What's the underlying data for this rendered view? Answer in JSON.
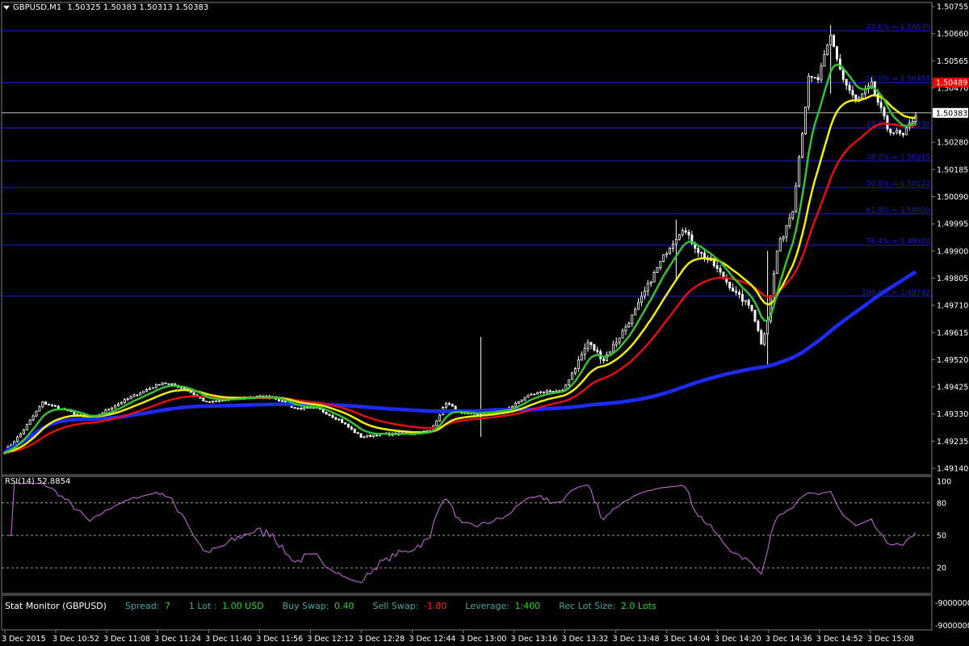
{
  "header": {
    "symbol_text": "GBPUSD,M1",
    "ohlc_text": "1.50325 1.50383 1.50313 1.50383"
  },
  "rsi_label": "RSI(14) 52.8854",
  "stat_monitor": {
    "title": "Stat Monitor (GBPUSD)",
    "spread_label": "Spread:",
    "spread_value": "7",
    "lot_label": "1 Lot :",
    "lot_value": "1.00 USD",
    "buy_swap_label": "Buy Swap:",
    "buy_swap_value": "0.40",
    "sell_swap_label": "Sell Swap:",
    "sell_swap_value": "-1.80",
    "leverage_label": "Leverage:",
    "leverage_value": "1:400",
    "rec_lot_label": "Rec Lot Size:",
    "rec_lot_value": "2.0 Lots"
  },
  "colors": {
    "background": "#000000",
    "grid": "#7f7f7f",
    "fib": "#1f1fd0",
    "candle": "#ffffff",
    "ema_fast": "#35c235",
    "ema_mid": "#f2f20f",
    "ema_slow": "#e01010",
    "sma_long": "#1d2bff",
    "rsi": "#b060c0",
    "current_price_line": "#c0c0c0",
    "price_tag": "#ff0000"
  },
  "chart_data": {
    "type": "candlestick",
    "price_axis": {
      "min": 1.4914,
      "max": 1.50755,
      "ticks": [
        "1.50755",
        "1.50660",
        "1.50565",
        "1.50470",
        "1.50375",
        "1.50280",
        "1.50185",
        "1.50090",
        "1.49995",
        "1.49900",
        "1.49805",
        "1.49710",
        "1.49615",
        "1.49520",
        "1.49425",
        "1.49330",
        "1.49235",
        "1.49140"
      ]
    },
    "time_labels": [
      "3 Dec 2015",
      "3 Dec 10:52",
      "3 Dec 11:08",
      "3 Dec 11:24",
      "3 Dec 11:40",
      "3 Dec 11:56",
      "3 Dec 12:12",
      "3 Dec 12:28",
      "3 Dec 12:44",
      "3 Dec 13:00",
      "3 Dec 13:16",
      "3 Dec 13:32",
      "3 Dec 13:48",
      "3 Dec 14:04",
      "3 Dec 14:20",
      "3 Dec 14:36",
      "3 Dec 14:52",
      "3 Dec 15:08"
    ],
    "fib_levels": [
      {
        "label": "23.6% = 1.50670",
        "price": 1.5067
      },
      {
        "label": "00.0% = 1.50489",
        "price": 1.50489
      },
      {
        "label": "23.6% = 1.50330",
        "price": 1.5033
      },
      {
        "label": "38.2% = 1.50215",
        "price": 1.50215
      },
      {
        "label": "50.0% = 1.50122",
        "price": 1.50122
      },
      {
        "label": "61.8% = 1.50030",
        "price": 1.5003
      },
      {
        "label": "76.4% = 1.49920",
        "price": 1.4992
      },
      {
        "label": "100.0% = 1.49742",
        "price": 1.49742
      }
    ],
    "current_price": {
      "text": "1.50383",
      "value": 1.50383
    },
    "high_price_tag": {
      "text": "1.50489",
      "value": 1.50489
    },
    "close_anchors": [
      [
        0,
        1.492
      ],
      [
        5,
        1.4926
      ],
      [
        12,
        1.4937
      ],
      [
        20,
        1.4934
      ],
      [
        27,
        1.4931
      ],
      [
        35,
        1.4936
      ],
      [
        42,
        1.494
      ],
      [
        50,
        1.4944
      ],
      [
        57,
        1.4942
      ],
      [
        64,
        1.4937
      ],
      [
        71,
        1.4938
      ],
      [
        78,
        1.4939
      ],
      [
        85,
        1.4939
      ],
      [
        92,
        1.4935
      ],
      [
        99,
        1.4935
      ],
      [
        106,
        1.4931
      ],
      [
        113,
        1.4925
      ],
      [
        120,
        1.4926
      ],
      [
        127,
        1.4926
      ],
      [
        135,
        1.4927
      ],
      [
        140,
        1.4937
      ],
      [
        145,
        1.4933
      ],
      [
        150,
        1.4933
      ],
      [
        160,
        1.4935
      ],
      [
        165,
        1.4939
      ],
      [
        172,
        1.4941
      ],
      [
        177,
        1.4941
      ],
      [
        185,
        1.4958
      ],
      [
        190,
        1.4952
      ],
      [
        195,
        1.496
      ],
      [
        200,
        1.4969
      ],
      [
        205,
        1.498
      ],
      [
        210,
        1.499
      ],
      [
        215,
        1.4998
      ],
      [
        220,
        1.499
      ],
      [
        225,
        1.4985
      ],
      [
        232,
        1.4975
      ],
      [
        237,
        1.497
      ],
      [
        240,
        1.4958
      ],
      [
        242,
        1.4966
      ],
      [
        245,
        1.499
      ],
      [
        250,
        1.5005
      ],
      [
        255,
        1.505
      ],
      [
        258,
        1.505
      ],
      [
        262,
        1.5065
      ],
      [
        266,
        1.505
      ],
      [
        270,
        1.5042
      ],
      [
        275,
        1.5048
      ],
      [
        280,
        1.5033
      ],
      [
        285,
        1.503
      ],
      [
        289,
        1.5038
      ]
    ],
    "wick_spikes": [
      {
        "index": 151,
        "high": 1.496,
        "low": 1.4925
      },
      {
        "index": 213,
        "high": 1.5001,
        "low": 1.498
      },
      {
        "index": 242,
        "high": 1.499,
        "low": 1.495
      },
      {
        "index": 262,
        "high": 1.5069,
        "low": 1.5045
      }
    ],
    "moving_averages": [
      {
        "name": "ema_fast",
        "period": 8
      },
      {
        "name": "ema_mid",
        "period": 18
      },
      {
        "name": "ema_slow",
        "period": 34
      },
      {
        "name": "sma_long",
        "period": 150
      }
    ],
    "rsi": {
      "period": 14,
      "levels": [
        20,
        50,
        80
      ],
      "axis_ticks": [
        "100",
        "80",
        "50",
        "20",
        "0"
      ]
    },
    "stat_axis_ticks": [
      "-9000000",
      "-9000000"
    ]
  }
}
